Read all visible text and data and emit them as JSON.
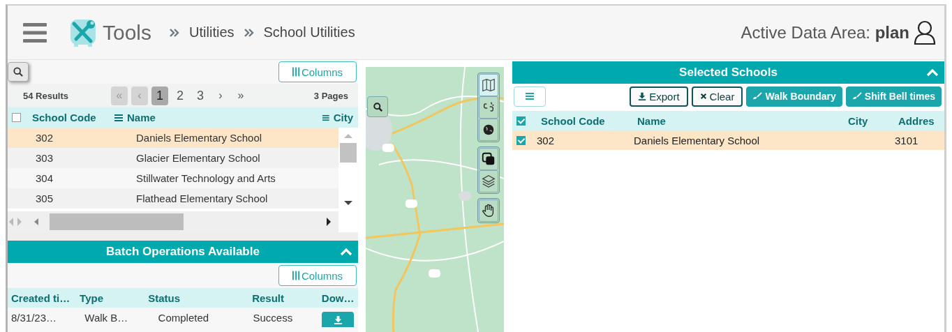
{
  "header": {
    "app_name": "Tools",
    "breadcrumbs": [
      "Utilities",
      "School Utilities"
    ],
    "active_data_area": "Active Data Area: **plan**"
  },
  "schools_grid": {
    "columns_button": "Columns",
    "results": "54 Results",
    "pager": [
      {
        "label": "«",
        "kind": "nav",
        "disabled": true,
        "selected": false
      },
      {
        "label": "‹",
        "kind": "nav",
        "disabled": true,
        "selected": false
      },
      {
        "label": "1",
        "kind": "page",
        "disabled": false,
        "selected": true
      },
      {
        "label": "2",
        "kind": "page",
        "disabled": false,
        "selected": false
      },
      {
        "label": "3",
        "kind": "page",
        "disabled": false,
        "selected": false
      },
      {
        "label": "›",
        "kind": "nav",
        "disabled": false,
        "selected": false
      },
      {
        "label": "»",
        "kind": "nav",
        "disabled": false,
        "selected": false
      }
    ],
    "page_count": "3 Pages",
    "select_all_checked": false,
    "columns": [
      {
        "label": "School Code",
        "menu": false
      },
      {
        "label": "Name",
        "menu": true
      },
      {
        "label": "City",
        "menu": true
      }
    ],
    "rows": [
      {
        "code": "302",
        "name": "Daniels Elementary School",
        "selected": true
      },
      {
        "code": "303",
        "name": "Glacier Elementary School",
        "selected": false
      },
      {
        "code": "304",
        "name": "Stillwater Technology and Arts",
        "selected": false
      },
      {
        "code": "305",
        "name": "Flathead Elementary School",
        "selected": false
      }
    ]
  },
  "batch_operations": {
    "title": "Batch Operations Available",
    "expanded": true,
    "columns_button": "Columns",
    "columns": [
      "Created ti…",
      "Type",
      "Status",
      "Result",
      "Dow…"
    ],
    "rows": [
      {
        "created": "8/31/23…",
        "type": "Walk B…",
        "status": "Completed",
        "result": "Success"
      }
    ]
  },
  "map": {
    "tool_groups": [
      [
        {
          "kind": "map",
          "selected": true
        },
        {
          "kind": "unlink",
          "selected": false
        },
        {
          "kind": "globe",
          "selected": false
        }
      ],
      [
        {
          "kind": "overlap",
          "selected": false
        },
        {
          "kind": "layers",
          "selected": false
        }
      ],
      [
        {
          "kind": "hand",
          "selected": false
        }
      ]
    ]
  },
  "selected_schools": {
    "title": "Selected Schools",
    "expanded": true,
    "actions": [
      {
        "label": "Export",
        "kind": "export"
      },
      {
        "label": "Clear",
        "kind": "clear"
      },
      {
        "label": "Walk Boundary",
        "kind": "batch"
      },
      {
        "label": "Shift Bell times",
        "kind": "batch"
      }
    ],
    "select_all_checked": true,
    "columns": [
      "School Code",
      "Name",
      "City",
      "Addres"
    ],
    "rows": [
      {
        "checked": true,
        "code": "302",
        "name": "Daniels Elementary School",
        "address": "3101"
      }
    ]
  }
}
